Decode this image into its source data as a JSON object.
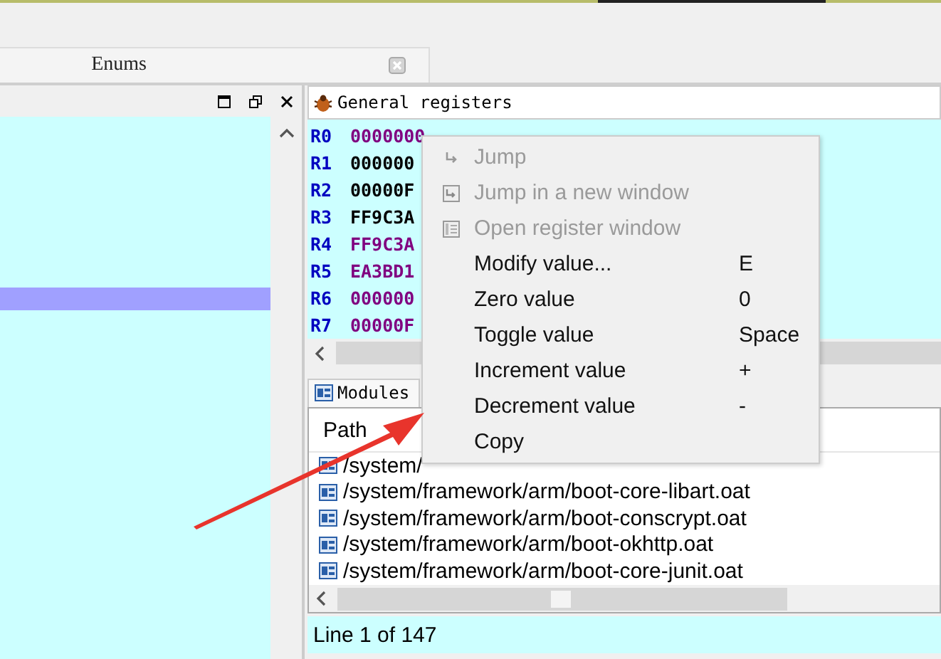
{
  "tab_bar": {
    "tabs": [
      {
        "label": "Enums",
        "selected": true
      }
    ]
  },
  "registers_panel": {
    "title": "General registers",
    "registers": [
      {
        "name": "R0",
        "value": "0000000",
        "color": "#800080"
      },
      {
        "name": "R1",
        "value": "000000",
        "color": "#000000"
      },
      {
        "name": "R2",
        "value": "00000F",
        "color": "#000000"
      },
      {
        "name": "R3",
        "value": "FF9C3A",
        "color": "#000000"
      },
      {
        "name": "R4",
        "value": "FF9C3A",
        "color": "#800080"
      },
      {
        "name": "R5",
        "value": "EA3BD1",
        "color": "#800080"
      },
      {
        "name": "R6",
        "value": "000000",
        "color": "#800080"
      },
      {
        "name": "R7",
        "value": "00000F",
        "color": "#800080"
      }
    ]
  },
  "modules_panel": {
    "title": "Modules",
    "columns": [
      "Path"
    ],
    "rows": [
      "/system/",
      "/system/framework/arm/boot-core-libart.oat",
      "/system/framework/arm/boot-conscrypt.oat",
      "/system/framework/arm/boot-okhttp.oat",
      "/system/framework/arm/boot-core-junit.oat"
    ],
    "status": "Line 1 of 147"
  },
  "context_menu": {
    "items": [
      {
        "label": "Jump",
        "disabled": true
      },
      {
        "label": "Jump in a new window",
        "disabled": true
      },
      {
        "label": "Open register window",
        "disabled": true
      },
      {
        "label": "Modify value...",
        "shortcut": "E",
        "disabled": false
      },
      {
        "label": "Zero value",
        "shortcut": "0",
        "disabled": false
      },
      {
        "label": "Toggle value",
        "shortcut": "Space",
        "disabled": false
      },
      {
        "label": "Increment value",
        "shortcut": "+",
        "disabled": false
      },
      {
        "label": "Decrement value",
        "shortcut": "-",
        "disabled": false
      },
      {
        "label": "Copy",
        "disabled": false
      }
    ]
  }
}
